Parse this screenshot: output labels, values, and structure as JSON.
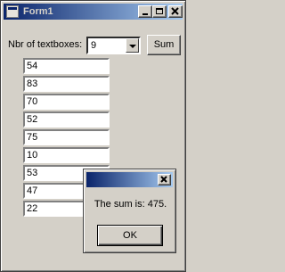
{
  "window": {
    "title": "Form1"
  },
  "form": {
    "label": "Nbr of textboxes:",
    "combo_value": "9",
    "sum_button": "Sum",
    "textboxes": [
      "54",
      "83",
      "70",
      "52",
      "75",
      "10",
      "53",
      "47",
      "22"
    ]
  },
  "dialog": {
    "message": "The sum is: 475.",
    "ok_button": "OK"
  },
  "colors": {
    "titlebar_start": "#0a246a",
    "titlebar_end": "#a6caf0",
    "face": "#d4d0c8"
  }
}
